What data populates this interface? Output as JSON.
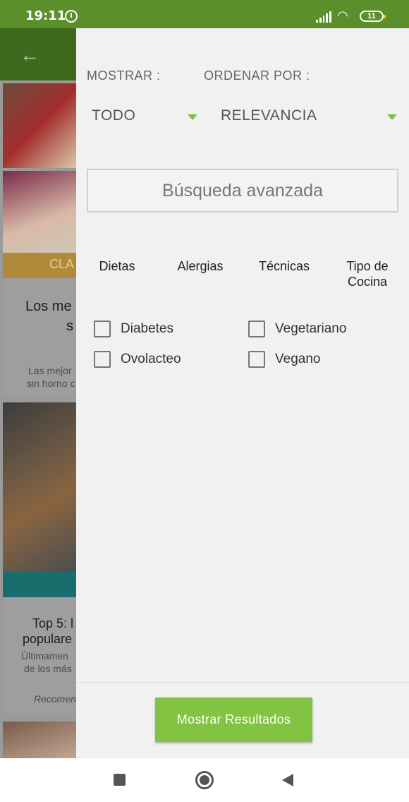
{
  "status_bar": {
    "time": "19:11",
    "battery": "11"
  },
  "background": {
    "category_tag": "CLA",
    "card1_title_line1": "Los me",
    "card1_title_line2": "s",
    "card1_desc_line1": "Las mejor",
    "card1_desc_line2": "sin horno c",
    "card2_title_line1": "Top 5: l",
    "card2_title_line2": "populare",
    "card2_desc_line1": "Últimamen",
    "card2_desc_line2": "de los más",
    "card2_recommended": "Recomen"
  },
  "filters": {
    "show_label": "MOSTRAR :",
    "order_label": "ORDENAR POR :",
    "show_value": "TODO",
    "order_value": "RELEVANCIA",
    "advanced_search": "Búsqueda avanzada",
    "tabs": [
      {
        "label": "Dietas"
      },
      {
        "label": "Alergias"
      },
      {
        "label": "Técnicas"
      },
      {
        "label": "Tipo de Cocina"
      }
    ],
    "options": [
      {
        "label": "Diabetes",
        "checked": false
      },
      {
        "label": "Vegetariano",
        "checked": false
      },
      {
        "label": "Ovolacteo",
        "checked": false
      },
      {
        "label": "Vegano",
        "checked": false
      }
    ],
    "submit_label": "Mostrar Resultados"
  },
  "colors": {
    "status_bar": "#5a8f2b",
    "accent": "#82c341",
    "drawer_bg": "#f1f1f1"
  }
}
